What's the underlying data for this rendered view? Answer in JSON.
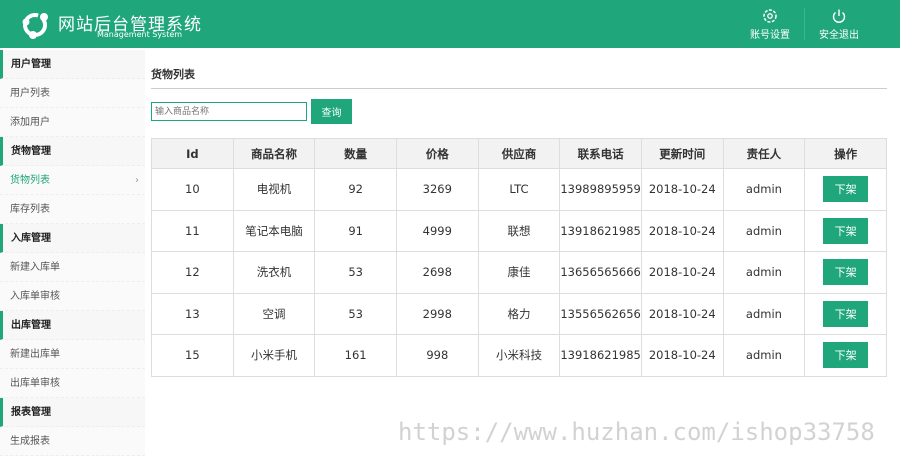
{
  "header": {
    "title": "网站后台管理系统",
    "subtitle": "Management System",
    "settings": "账号设置",
    "logout": "安全退出"
  },
  "sidebar": [
    {
      "label": "用户管理",
      "type": "group"
    },
    {
      "label": "用户列表"
    },
    {
      "label": "添加用户"
    },
    {
      "label": "货物管理",
      "type": "group"
    },
    {
      "label": "货物列表",
      "active": true
    },
    {
      "label": "库存列表"
    },
    {
      "label": "入库管理",
      "type": "group"
    },
    {
      "label": "新建入库单"
    },
    {
      "label": "入库单审核"
    },
    {
      "label": "出库管理",
      "type": "group"
    },
    {
      "label": "新建出库单"
    },
    {
      "label": "出库单审核"
    },
    {
      "label": "报表管理",
      "type": "group"
    },
    {
      "label": "生成报表"
    }
  ],
  "main": {
    "title": "货物列表",
    "search_placeholder": "输入商品名称",
    "search_btn": "查询",
    "columns": [
      "Id",
      "商品名称",
      "数量",
      "价格",
      "供应商",
      "联系电话",
      "更新时间",
      "责任人",
      "操作"
    ],
    "rows": [
      [
        "10",
        "电视机",
        "92",
        "3269",
        "LTC",
        "13989895959",
        "2018-10-24",
        "admin"
      ],
      [
        "11",
        "笔记本电脑",
        "91",
        "4999",
        "联想",
        "13918621985",
        "2018-10-24",
        "admin"
      ],
      [
        "12",
        "洗衣机",
        "53",
        "2698",
        "康佳",
        "13656565666",
        "2018-10-24",
        "admin"
      ],
      [
        "13",
        "空调",
        "53",
        "2998",
        "格力",
        "13556562656",
        "2018-10-24",
        "admin"
      ],
      [
        "15",
        "小米手机",
        "161",
        "998",
        "小米科技",
        "13918621985",
        "2018-10-24",
        "admin"
      ]
    ],
    "action": "下架"
  },
  "watermark": "https://www.huzhan.com/ishop33758"
}
